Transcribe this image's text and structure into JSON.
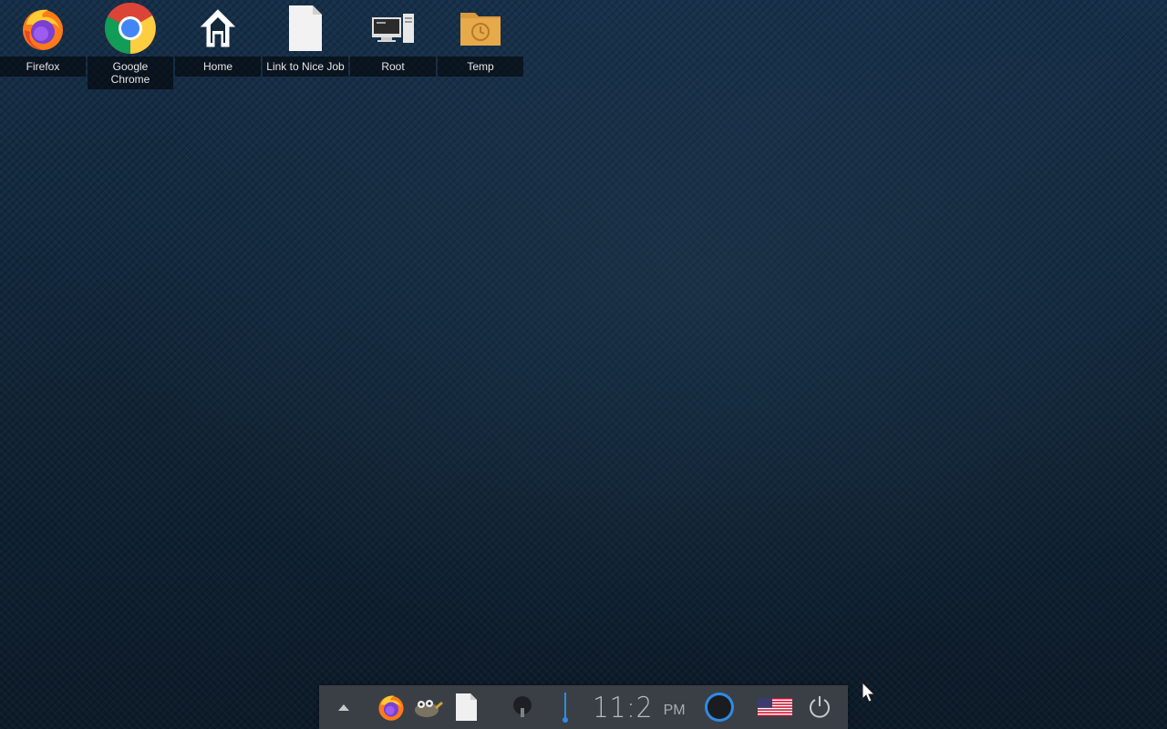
{
  "desktop": {
    "icons": [
      {
        "label": "Firefox",
        "icon": "firefox-icon"
      },
      {
        "label": "Google\nChrome",
        "icon": "chrome-icon"
      },
      {
        "label": "Home",
        "icon": "home-icon"
      },
      {
        "label": "Link to Nice Job",
        "icon": "file-icon"
      },
      {
        "label": "Root",
        "icon": "computer-icon"
      },
      {
        "label": "Temp",
        "icon": "temp-folder-icon"
      }
    ]
  },
  "taskbar": {
    "clock": {
      "time": "11:2",
      "ampm": "PM"
    },
    "icons": [
      "expand-arrow-icon",
      "firefox-icon",
      "gimp-icon",
      "file-icon",
      "microphone-icon",
      "volume-icon",
      "network-circle-icon",
      "us-flag-icon",
      "power-icon"
    ]
  },
  "colors": {
    "taskbar_bg": "#3a3f45",
    "accent_blue": "#2f8be6",
    "desktop_bg": "#12273a"
  }
}
